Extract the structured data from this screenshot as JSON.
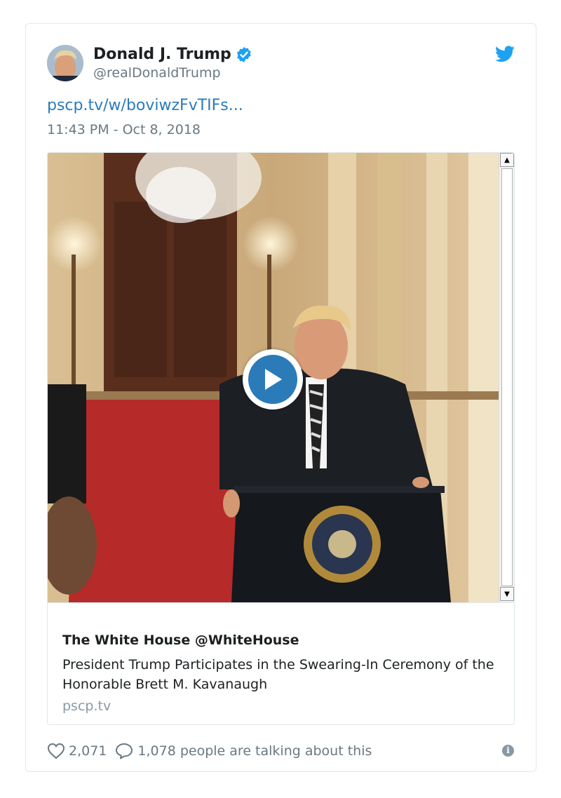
{
  "tweet": {
    "author_name": "Donald J. Trump",
    "author_handle": "@realDonaldTrump",
    "link_text": "pscp.tv/w/boviwzFvTIFs...",
    "timestamp": "11:43 PM - Oct 8, 2018",
    "likes": "2,071",
    "talking": "1,078 people are talking about this",
    "info_glyph": "i"
  },
  "media_card": {
    "author": "The White House @WhiteHouse",
    "description": "President Trump Participates in the Swearing-In Ceremony of the Honorable Brett M. Kavanaugh",
    "domain": "pscp.tv"
  },
  "scrollbar": {
    "up_glyph": "▲",
    "down_glyph": "▼"
  },
  "icons": [
    "verified-badge-icon",
    "twitter-bird-icon",
    "play-icon",
    "heart-icon",
    "reply-bubble-icon",
    "info-icon"
  ],
  "colors": {
    "link": "#2b7bb9",
    "verified": "#1da1f2",
    "muted": "#697882",
    "play": "#2b7bb9"
  }
}
